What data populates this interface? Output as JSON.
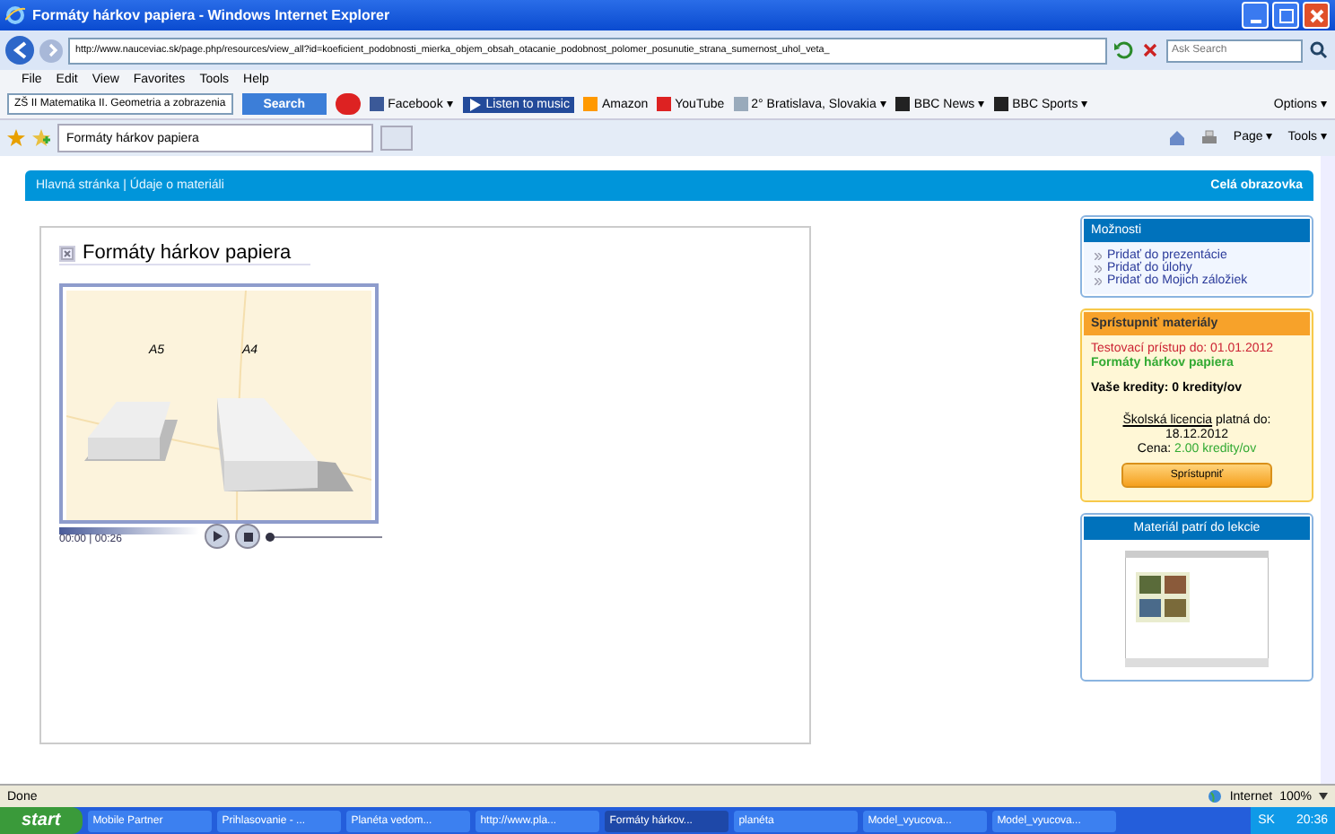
{
  "window": {
    "title": "Formáty hárkov papiera - Windows Internet Explorer"
  },
  "address_bar": {
    "url": "http://www.nauceviac.sk/page.php/resources/view_all?id=koeficient_podobnosti_mierka_objem_obsah_otacanie_podobnost_polomer_posunutie_strana_sumernost_uhol_veta_",
    "search_placeholder": "Ask Search"
  },
  "menu": [
    "File",
    "Edit",
    "View",
    "Favorites",
    "Tools",
    "Help"
  ],
  "toolbar": {
    "search_value": "ZŠ II  Matematika  II. Geometria a zobrazenia",
    "search_button": "Search",
    "items": [
      {
        "kind": "facebook",
        "label": "Facebook ▾"
      },
      {
        "kind": "music",
        "label": "Listen to music"
      },
      {
        "kind": "amazon",
        "label": "Amazon"
      },
      {
        "kind": "youtube",
        "label": "YouTube"
      },
      {
        "kind": "weather",
        "label": "2° Bratislava, Slovakia ▾"
      },
      {
        "kind": "bbc",
        "label": "BBC News ▾"
      },
      {
        "kind": "bbc",
        "label": "BBC Sports ▾"
      }
    ],
    "options": "Options ▾"
  },
  "tab": {
    "label": "Formáty hárkov papiera"
  },
  "command_bar": [
    "Page ▾",
    "Tools ▾"
  ],
  "page": {
    "breadcrumb": "Hlavná stránka | Údaje o materiáli",
    "fullscreen": "Celá obrazovka",
    "material_title": "Formáty hárkov papiera",
    "video": {
      "labels": [
        "A5",
        "A4"
      ],
      "time": "00:00 | 00:26",
      "seek": {
        "level": 0
      }
    },
    "options_panel": {
      "title": "Možnosti",
      "links": [
        "Pridať do prezentácie",
        "Pridať do úlohy",
        "Pridať do Mojich záložiek"
      ]
    },
    "access_panel": {
      "title": "Sprístupniť materiály",
      "trial": "Testovací prístup do: 01.01.2012",
      "material": "Formáty hárkov papiera",
      "credits": "Vaše kredity: 0 kredity/ov",
      "license_link": "Školská licencia",
      "license_text": "platná do:",
      "license_date": "18.12.2012",
      "price_label": "Cena:",
      "price": "2.00 kredity/ov",
      "button": "Sprístupniť"
    },
    "lesson_panel": {
      "title": "Materiál patrí do lekcie"
    }
  },
  "status_bar": {
    "text": "Done",
    "zone": "Internet",
    "zoom": "100%"
  },
  "taskbar": {
    "start": "start",
    "items": [
      {
        "label": "Mobile Partner",
        "selected": false
      },
      {
        "label": "Prihlasovanie - ...",
        "selected": false
      },
      {
        "label": "Planéta vedom...",
        "selected": false
      },
      {
        "label": "http://www.pla...",
        "selected": false
      },
      {
        "label": "Formáty hárkov...",
        "selected": true
      },
      {
        "label": "planéta",
        "selected": false
      },
      {
        "label": "Model_vyucova...",
        "selected": false
      },
      {
        "label": "Model_vyucova...",
        "selected": false
      }
    ],
    "lang": "SK",
    "clock": "20:36"
  }
}
